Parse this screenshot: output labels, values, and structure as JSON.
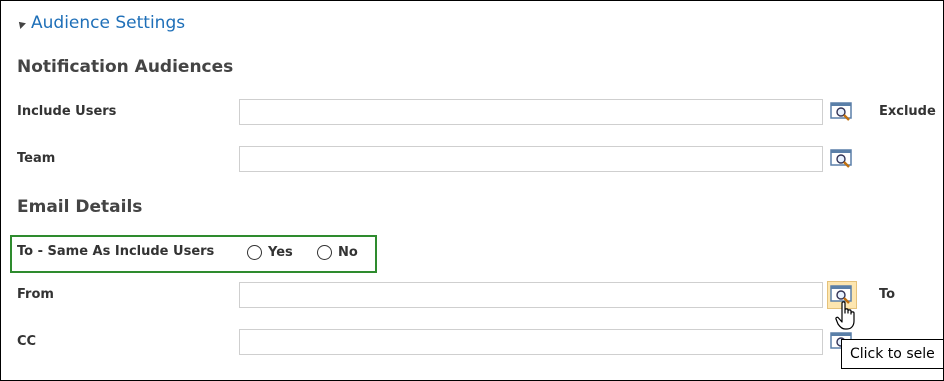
{
  "section": {
    "title": "Audience Settings"
  },
  "notification": {
    "heading": "Notification Audiences",
    "include_users_label": "Include Users",
    "exclude_label": "Exclude",
    "team_label": "Team"
  },
  "email": {
    "heading": "Email Details",
    "to_same_label": "To - Same As Include Users",
    "options": {
      "yes": "Yes",
      "no": "No"
    },
    "from_label": "From",
    "to_label": "To",
    "cc_label": "CC"
  },
  "tooltip": {
    "text": "Click to sele"
  },
  "colors": {
    "accent": "#1e6fb8",
    "highlight_border": "#2e8b2e",
    "active_lookup": "#fde6b0"
  },
  "icons": {
    "lookup": "lookup-icon",
    "collapse": "triangle-collapse-icon",
    "cursor": "hand-cursor-icon"
  }
}
